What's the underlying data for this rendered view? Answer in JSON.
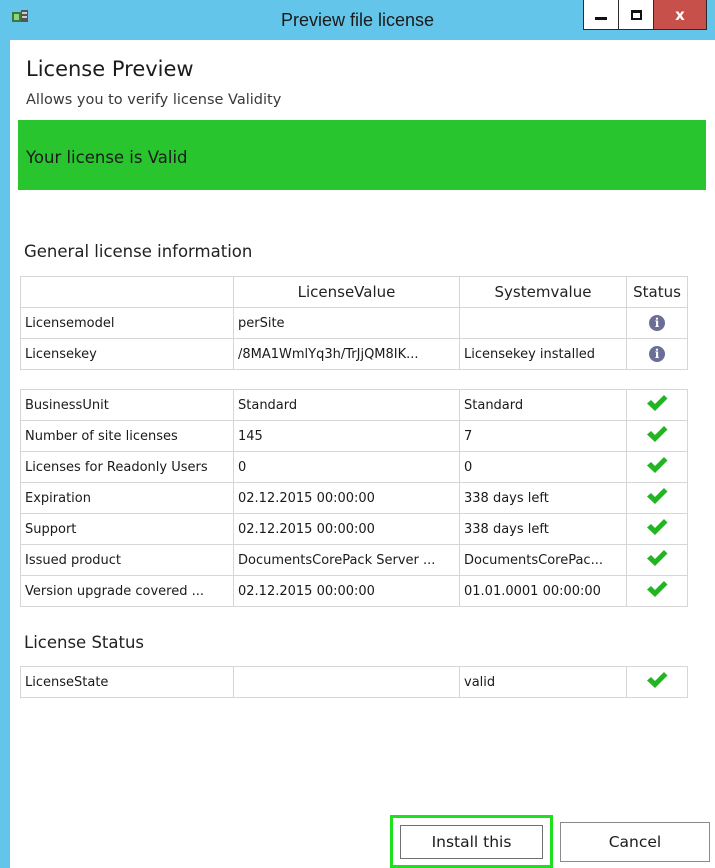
{
  "window": {
    "title": "Preview file license",
    "close_glyph": "x"
  },
  "header": {
    "title": "License Preview",
    "subtitle": "Allows you to verify license Validity"
  },
  "banner": {
    "text": "Your license is Valid",
    "color": "#29c52e"
  },
  "general": {
    "title": "General license information",
    "columns": [
      "",
      "LicenseValue",
      "Systemvalue",
      "Status"
    ],
    "rows_a": [
      {
        "name": "Licensemodel",
        "license_value": "perSite",
        "system_value": "",
        "status": "info-icon"
      },
      {
        "name": "Licensekey",
        "license_value": "/8MA1WmlYq3h/TrJjQM8IK...",
        "system_value": "Licensekey installed",
        "status": "info-icon"
      }
    ],
    "rows_b": [
      {
        "name": "BusinessUnit",
        "license_value": "Standard",
        "system_value": "Standard",
        "status": "check-icon"
      },
      {
        "name": "Number of site licenses",
        "license_value": "145",
        "system_value": "7",
        "status": "check-icon"
      },
      {
        "name": "Licenses for Readonly Users",
        "license_value": "0",
        "system_value": "0",
        "status": "check-icon"
      },
      {
        "name": "Expiration",
        "license_value": "02.12.2015 00:00:00",
        "system_value": "338 days left",
        "status": "check-icon"
      },
      {
        "name": "Support",
        "license_value": "02.12.2015 00:00:00",
        "system_value": "338 days left",
        "status": "check-icon"
      },
      {
        "name": "Issued product",
        "license_value": "DocumentsCorePack Server ...",
        "system_value": "DocumentsCorePac...",
        "status": "check-icon"
      },
      {
        "name": "Version upgrade covered ...",
        "license_value": "02.12.2015 00:00:00",
        "system_value": "01.01.0001 00:00:00",
        "status": "check-icon"
      }
    ]
  },
  "license_status": {
    "title": "License Status",
    "rows": [
      {
        "name": "LicenseState",
        "license_value": "",
        "system_value": "valid",
        "status": "check-icon"
      }
    ]
  },
  "buttons": {
    "install": "Install this",
    "cancel": "Cancel"
  },
  "colors": {
    "titlebar": "#63c5e9",
    "check": "#21b521",
    "info": "#6b6e96",
    "close": "#c7504a",
    "install_highlight": "#1ee01e"
  }
}
